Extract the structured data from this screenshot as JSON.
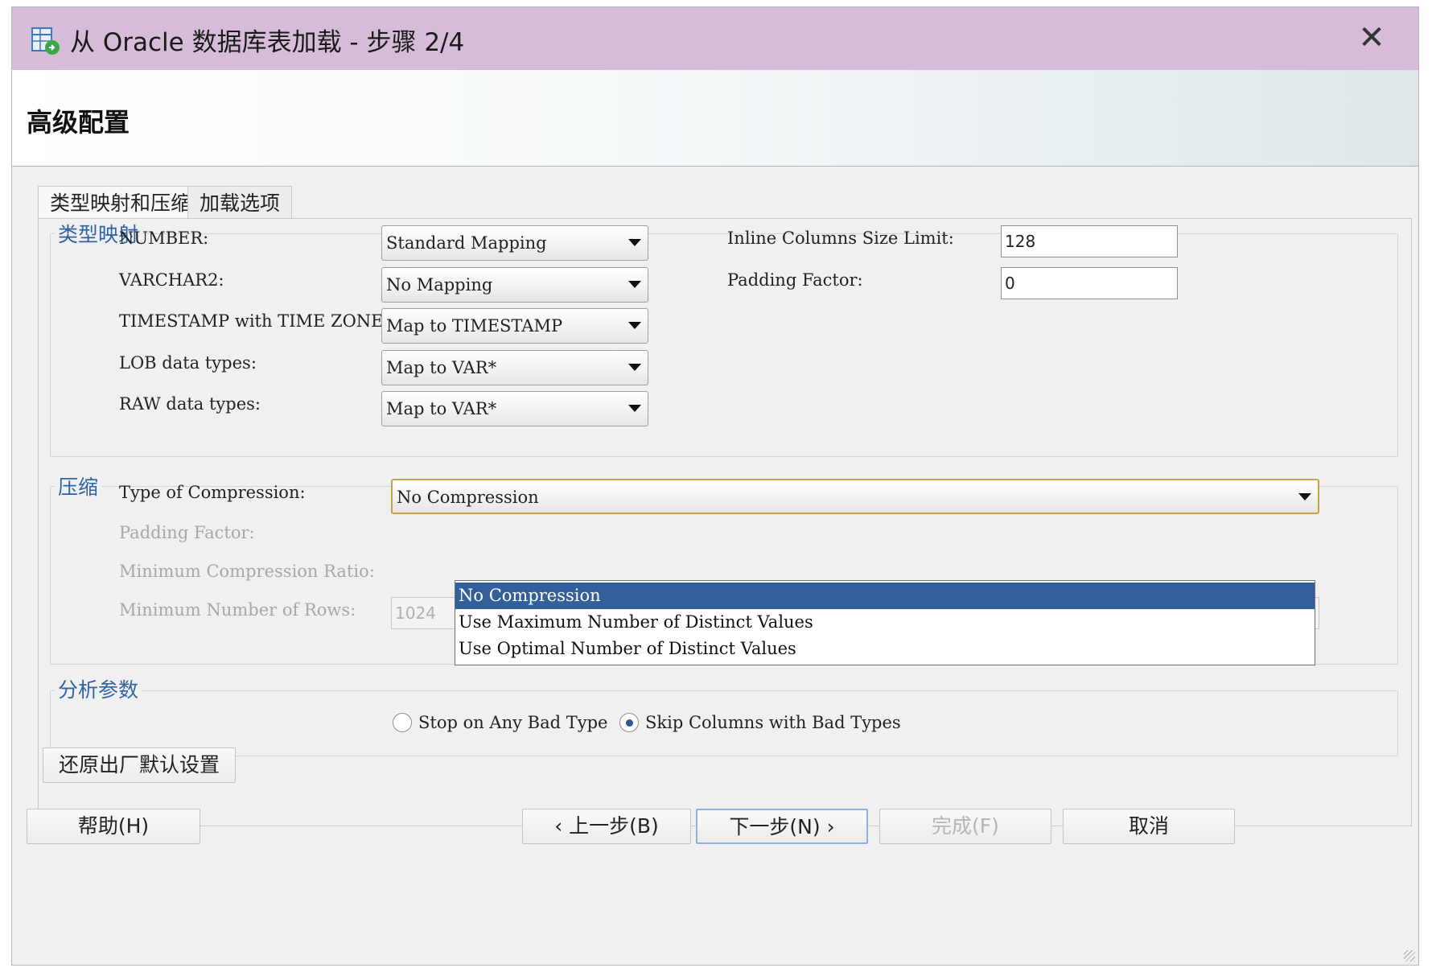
{
  "window": {
    "title": "从 Oracle 数据库表加载 - 步骤 2/4",
    "close_symbol": "✕"
  },
  "header": {
    "title": "高级配置"
  },
  "tabs": [
    {
      "label": "类型映射和压缩",
      "active": true
    },
    {
      "label": "加载选项",
      "active": false
    }
  ],
  "type_mapping": {
    "legend": "类型映射",
    "rows": [
      {
        "label": "NUMBER:",
        "value": "Standard Mapping"
      },
      {
        "label": "VARCHAR2:",
        "value": "No Mapping"
      },
      {
        "label": "TIMESTAMP with TIME ZONE:",
        "value": "Map to TIMESTAMP"
      },
      {
        "label": "LOB data types:",
        "value": "Map to VAR*"
      },
      {
        "label": "RAW data types:",
        "value": "Map to VAR*"
      }
    ],
    "inline_columns_size_limit": {
      "label": "Inline Columns Size Limit:",
      "value": "128"
    },
    "padding_factor": {
      "label": "Padding Factor:",
      "value": "0"
    }
  },
  "compression": {
    "legend": "压缩",
    "type_label": "Type of Compression:",
    "type_value": "No Compression",
    "padding_factor_label": "Padding Factor:",
    "min_ratio_label": "Minimum Compression Ratio:",
    "min_rows_label": "Minimum Number of Rows:",
    "min_rows_value": "1024",
    "options": [
      {
        "label": "No Compression",
        "selected": true
      },
      {
        "label": "Use Maximum Number of Distinct Values",
        "selected": false
      },
      {
        "label": "Use Optimal Number of Distinct Values",
        "selected": false
      }
    ]
  },
  "analysis": {
    "legend": "分析参数",
    "radio_stop": {
      "label": "Stop on Any Bad Type",
      "checked": false
    },
    "radio_skip": {
      "label": "Skip Columns with Bad Types",
      "checked": true
    }
  },
  "buttons": {
    "restore_defaults": "还原出厂默认设置",
    "help": "帮助(H)",
    "back": "‹ 上一步(B)",
    "next": "下一步(N) ›",
    "finish": "完成(F)",
    "cancel": "取消"
  },
  "colors": {
    "titlebar": "#d6bcd9",
    "legend_text": "#2f63a6",
    "list_selection": "#33609a",
    "focus_border": "#c7a24b"
  },
  "icons": {
    "app": "wizard-table-load-icon",
    "close": "close-icon",
    "dropdown": "chevron-down-icon"
  }
}
